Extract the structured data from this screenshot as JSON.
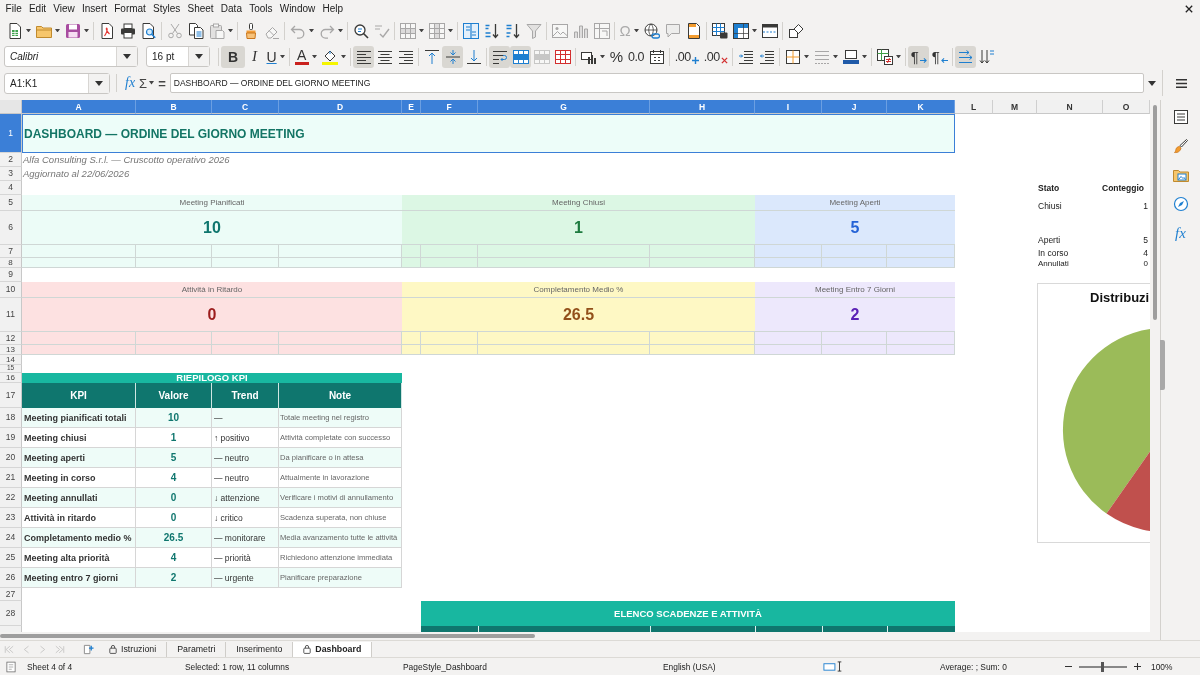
{
  "menu_bar": {
    "items": [
      "File",
      "Edit",
      "View",
      "Insert",
      "Format",
      "Styles",
      "Sheet",
      "Data",
      "Tools",
      "Window",
      "Help"
    ]
  },
  "standard_toolbar": {
    "groups": [
      [
        {
          "kind": "new",
          "disabled": false,
          "dropdown": true
        },
        {
          "kind": "open",
          "disabled": false,
          "dropdown": true
        },
        {
          "kind": "save",
          "disabled": false,
          "dropdown": true
        }
      ],
      [
        {
          "kind": "pdf",
          "disabled": false
        },
        {
          "kind": "print",
          "disabled": false
        },
        {
          "kind": "preview",
          "disabled": false
        }
      ],
      [
        {
          "kind": "cut",
          "disabled": true
        },
        {
          "kind": "copy",
          "disabled": false
        },
        {
          "kind": "paste",
          "disabled": true,
          "dropdown": true
        }
      ],
      [
        {
          "kind": "clone",
          "disabled": false
        },
        {
          "kind": "clear",
          "disabled": true
        }
      ],
      [
        {
          "kind": "undo",
          "disabled": true,
          "dropdown": true
        },
        {
          "kind": "redo",
          "disabled": true,
          "dropdown": true
        }
      ],
      [
        {
          "kind": "find",
          "disabled": false
        },
        {
          "kind": "spelling",
          "disabled": true
        }
      ],
      [
        {
          "kind": "row",
          "disabled": true,
          "dropdown": true
        },
        {
          "kind": "column",
          "disabled": true,
          "dropdown": true
        }
      ],
      [
        {
          "kind": "sort",
          "disabled": false
        },
        {
          "kind": "ascending",
          "disabled": false
        },
        {
          "kind": "descending",
          "disabled": false
        },
        {
          "kind": "autofilter",
          "disabled": true
        }
      ],
      [
        {
          "kind": "image",
          "disabled": true
        },
        {
          "kind": "chart",
          "disabled": true
        },
        {
          "kind": "pivot",
          "disabled": true
        }
      ],
      [
        {
          "kind": "special",
          "label": "Ω",
          "disabled": true,
          "dropdown": true
        },
        {
          "kind": "hyperlink",
          "disabled": false
        },
        {
          "kind": "comment",
          "disabled": true
        },
        {
          "kind": "headerfooter",
          "disabled": false
        }
      ],
      [
        {
          "kind": "printarea",
          "disabled": false
        },
        {
          "kind": "freeze",
          "disabled": false,
          "dropdown": true
        },
        {
          "kind": "split",
          "disabled": false
        }
      ],
      [
        {
          "kind": "draw",
          "disabled": false
        }
      ]
    ]
  },
  "formatting_toolbar": {
    "font_name": "Calibri",
    "font_size": "16 pt",
    "groups": [
      [
        {
          "kind": "bold",
          "label": "B",
          "on": true,
          "disabled": false
        },
        {
          "kind": "italic",
          "label": "I",
          "on": false,
          "disabled": false
        },
        {
          "kind": "underline",
          "label": "U",
          "on": false,
          "disabled": false,
          "dropdown": true
        }
      ],
      [
        {
          "kind": "fontcolor",
          "label": "A",
          "on": false,
          "disabled": false,
          "dropdown": true
        },
        {
          "kind": "highlight",
          "on": false,
          "disabled": false,
          "dropdown": true
        }
      ],
      [
        {
          "kind": "left",
          "on": true,
          "disabled": false
        },
        {
          "kind": "center",
          "on": false,
          "disabled": false
        },
        {
          "kind": "right",
          "on": false,
          "disabled": false
        }
      ],
      [
        {
          "kind": "top",
          "on": false,
          "disabled": false
        },
        {
          "kind": "middle",
          "on": true,
          "disabled": false
        },
        {
          "kind": "bottom",
          "on": false,
          "disabled": false
        }
      ],
      [
        {
          "kind": "wrap",
          "on": true,
          "disabled": false
        },
        {
          "kind": "mergecenter",
          "on": true,
          "disabled": false
        },
        {
          "kind": "merge",
          "on": false,
          "disabled": true
        },
        {
          "kind": "unmerge",
          "on": false,
          "disabled": false
        }
      ],
      [
        {
          "kind": "currency",
          "on": false,
          "disabled": false,
          "dropdown": true
        },
        {
          "kind": "percent",
          "label": "%",
          "on": false,
          "disabled": false
        },
        {
          "kind": "number",
          "label": "0.0",
          "on": false,
          "disabled": false
        },
        {
          "kind": "date",
          "on": false,
          "disabled": false
        }
      ],
      [
        {
          "kind": "adddecimal",
          "label": ".00",
          "on": false,
          "disabled": false
        },
        {
          "kind": "deletedecimal",
          "label": ".00",
          "on": false,
          "disabled": false
        }
      ],
      [
        {
          "kind": "indent",
          "on": false,
          "disabled": false
        },
        {
          "kind": "outdent",
          "on": false,
          "disabled": false
        }
      ],
      [
        {
          "kind": "borders",
          "on": false,
          "disabled": false,
          "dropdown": true
        },
        {
          "kind": "borderstyle",
          "on": false,
          "disabled": true,
          "dropdown": true
        },
        {
          "kind": "bordercolor",
          "on": false,
          "disabled": false,
          "dropdown": true
        }
      ],
      [
        {
          "kind": "conditional",
          "on": false,
          "disabled": false,
          "dropdown": true
        }
      ],
      [
        {
          "kind": "ltr",
          "label": "¶",
          "on": true,
          "disabled": false
        },
        {
          "kind": "rtl",
          "label": "¶",
          "on": false,
          "disabled": false
        }
      ],
      [
        {
          "kind": "textdirection",
          "on": true,
          "disabled": false
        },
        {
          "kind": "sortvertical",
          "on": false,
          "disabled": false
        }
      ]
    ]
  },
  "formula_bar": {
    "name_box": "A1:K1",
    "function_wizard": "fx",
    "sum": "Σ",
    "equals": "=",
    "content": "DASHBOARD — ORDINE DEL GIORNO MEETING"
  },
  "sheet": {
    "columns": [
      {
        "label": "A",
        "selected": true
      },
      {
        "label": "B",
        "selected": true
      },
      {
        "label": "C",
        "selected": true
      },
      {
        "label": "D",
        "selected": true
      },
      {
        "label": "E",
        "selected": true
      },
      {
        "label": "F",
        "selected": true
      },
      {
        "label": "G",
        "selected": true
      },
      {
        "label": "H",
        "selected": true
      },
      {
        "label": "I",
        "selected": true
      },
      {
        "label": "J",
        "selected": true
      },
      {
        "label": "K",
        "selected": true
      },
      {
        "label": "L",
        "selected": false
      },
      {
        "label": "M",
        "selected": false
      },
      {
        "label": "N",
        "selected": false
      },
      {
        "label": "O",
        "selected": false
      }
    ],
    "rows": [
      {
        "label": "1",
        "selected": true
      },
      {
        "label": "2",
        "selected": false
      },
      {
        "label": "3",
        "selected": false
      },
      {
        "label": "4",
        "selected": false
      },
      {
        "label": "5",
        "selected": false
      },
      {
        "label": "6",
        "selected": false
      },
      {
        "label": "7",
        "selected": false
      },
      {
        "label": "8",
        "selected": false
      },
      {
        "label": "9",
        "selected": false
      },
      {
        "label": "10",
        "selected": false
      },
      {
        "label": "11",
        "selected": false
      },
      {
        "label": "12",
        "selected": false
      },
      {
        "label": "13",
        "selected": false
      },
      {
        "label": "14",
        "selected": false
      },
      {
        "label": "15",
        "selected": false
      },
      {
        "label": "16",
        "selected": false
      },
      {
        "label": "17",
        "selected": false
      },
      {
        "label": "18",
        "selected": false
      },
      {
        "label": "19",
        "selected": false
      },
      {
        "label": "20",
        "selected": false
      },
      {
        "label": "21",
        "selected": false
      },
      {
        "label": "22",
        "selected": false
      },
      {
        "label": "23",
        "selected": false
      },
      {
        "label": "24",
        "selected": false
      },
      {
        "label": "25",
        "selected": false
      },
      {
        "label": "26",
        "selected": false
      },
      {
        "label": "27",
        "selected": false
      },
      {
        "label": "28",
        "selected": false
      }
    ],
    "title": "DASHBOARD — ORDINE DEL GIORNO MEETING",
    "subtitle": "Alfa Consulting S.r.l. — Cruscotto operativo 2026",
    "updated": "Aggiornato al 22/06/2026",
    "cards": [
      {
        "label": "Meeting Pianificati",
        "value": {
          "text": "10",
          "color": "#0f766e"
        },
        "color": "#ecfcf7"
      },
      {
        "label": "Meeting Chiusi",
        "value": {
          "text": "1",
          "color": "#1e7b3f"
        },
        "color": "#dcf7e4"
      },
      {
        "label": "Meeting Aperti",
        "value": {
          "text": "5",
          "color": "#2563d6"
        },
        "color": "#dbe8fc"
      },
      {
        "label": "Attività in Ritardo",
        "value": {
          "text": "0",
          "color": "#9b1c1c"
        },
        "color": "#fde1e1"
      },
      {
        "label": "Completamento Medio %",
        "value": {
          "text": "26.5",
          "color": "#92501a"
        },
        "color": "#fef8c4"
      },
      {
        "label": "Meeting Entro 7 Giorni",
        "value": {
          "text": "2",
          "color": "#5b21b6"
        },
        "color": "#ede8fc"
      }
    ],
    "status_table": {
      "columns": [
        "Stato",
        "Conteggio"
      ],
      "rows": [
        {
          "status": "Chiusi",
          "count": "1"
        },
        {
          "status": "Aperti",
          "count": "5"
        },
        {
          "status": "In corso",
          "count": "4"
        },
        {
          "status": "Annullati",
          "count": "0"
        }
      ]
    },
    "kpi_table": {
      "title": "RIEPILOGO KPI",
      "columns": [
        "KPI",
        "Valore",
        "Trend",
        "Note"
      ],
      "rows": [
        {
          "kpi": "Meeting pianificati totali",
          "value": "10",
          "trend": "—",
          "note": "Totale meeting nel registro"
        },
        {
          "kpi": "Meeting chiusi",
          "value": "1",
          "trend": "↑ positivo",
          "note": "Attività completate con successo"
        },
        {
          "kpi": "Meeting aperti",
          "value": "5",
          "trend": "— neutro",
          "note": "Da pianificare o in attesa"
        },
        {
          "kpi": "Meeting in corso",
          "value": "4",
          "trend": "— neutro",
          "note": "Attualmente in lavorazione"
        },
        {
          "kpi": "Meeting annullati",
          "value": "0",
          "trend": "↓ attenzione",
          "note": "Verificare i motivi di annullamento"
        },
        {
          "kpi": "Attività in ritardo",
          "value": "0",
          "trend": "↓ critico",
          "note": "Scadenza superata, non chiuse"
        },
        {
          "kpi": "Completamento medio %",
          "value": "26.5",
          "trend": "— monitorare",
          "note": "Media avanzamento tutte le attività"
        },
        {
          "kpi": "Meeting alta priorità",
          "value": "4",
          "trend": "— priorità",
          "note": "Richiedono attenzione immediata"
        },
        {
          "kpi": "Meeting entro 7 giorni",
          "value": "2",
          "trend": "— urgente",
          "note": "Pianificare preparazione"
        }
      ]
    },
    "deadlines_table": {
      "title": "ELENCO SCADENZE E ATTIVITÀ"
    },
    "chart": {
      "title": "Distribuzi"
    }
  },
  "sidebar": {
    "functions": "fx"
  },
  "tab_navigation": [
    {
      "kind": "first",
      "disabled": true
    },
    {
      "kind": "previous",
      "disabled": true
    },
    {
      "kind": "next",
      "disabled": true
    },
    {
      "kind": "last",
      "disabled": true
    }
  ],
  "sheet_tabs": [
    {
      "label": "Istruzioni",
      "locked": true,
      "selected": false
    },
    {
      "label": "Parametri",
      "locked": false,
      "selected": false
    },
    {
      "label": "Inserimento",
      "locked": false,
      "selected": false
    },
    {
      "label": "Dashboard",
      "locked": true,
      "selected": true
    }
  ],
  "status_bar": {
    "sheet": "Sheet 4 of 4",
    "selection": "Selected: 1 row, 11 columns",
    "page_style": "PageStyle_Dashboard",
    "language": "English (USA)",
    "statistics": "Average: ; Sum: 0",
    "zoom_slider": {
      "level": 0.47
    },
    "zoom": "100%"
  }
}
